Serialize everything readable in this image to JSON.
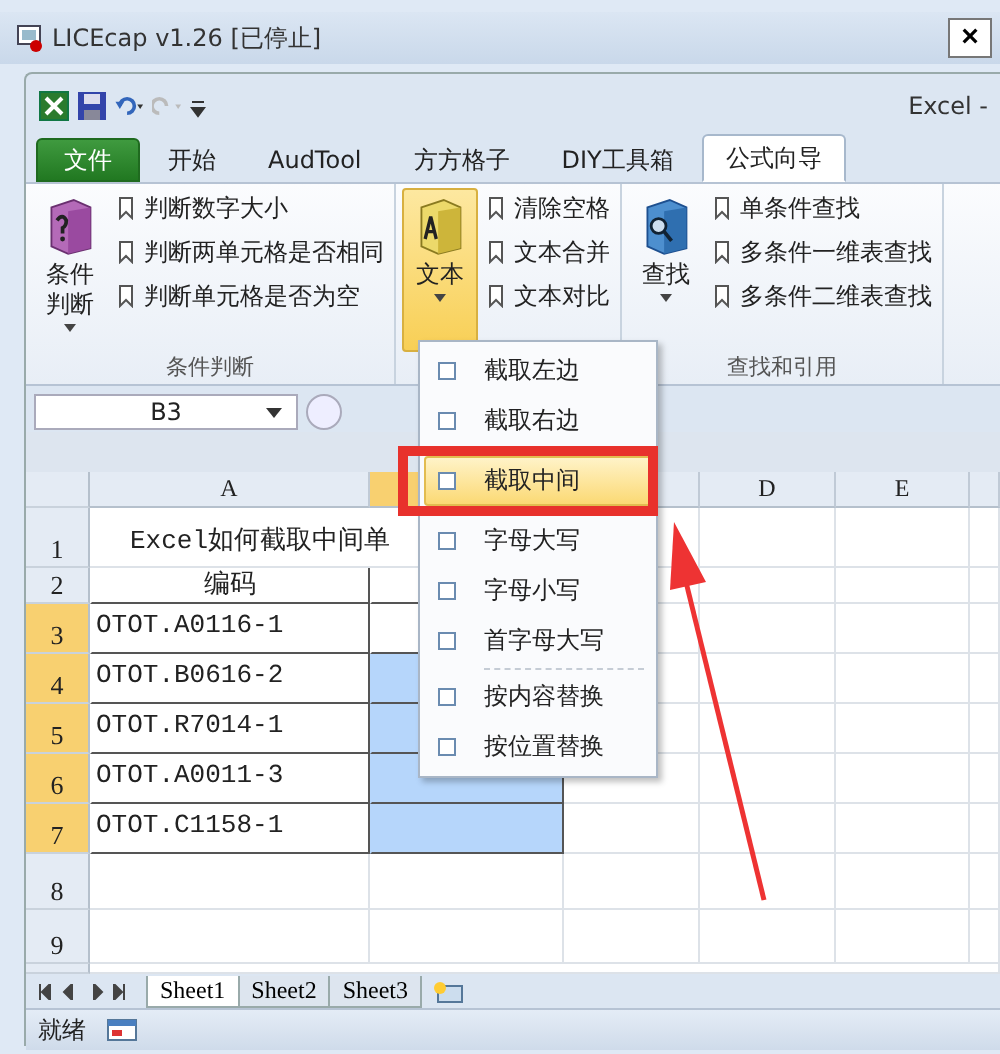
{
  "window": {
    "title": "LICEcap v1.26 [已停止]",
    "close": "×"
  },
  "app_label": "Excel -",
  "tabs": [
    {
      "label": "文件",
      "kind": "file",
      "selected": false
    },
    {
      "label": "开始",
      "kind": "normal",
      "selected": false
    },
    {
      "label": "AudTool",
      "kind": "normal",
      "selected": false
    },
    {
      "label": "方方格子",
      "kind": "normal",
      "selected": false
    },
    {
      "label": "DIY工具箱",
      "kind": "normal",
      "selected": false
    },
    {
      "label": "公式向导",
      "kind": "normal",
      "selected": true
    }
  ],
  "ribbon_groups": [
    {
      "label": "条件判断",
      "big_button": {
        "label": "条件判断",
        "expanded": false
      },
      "items": [
        "判断数字大小",
        "判断两单元格是否相同",
        "判断单元格是否为空"
      ]
    },
    {
      "big_button": {
        "label": "文本",
        "expanded": true
      },
      "items": [
        "清除空格",
        "文本合并",
        "文本对比"
      ]
    },
    {
      "label": "查找和引用",
      "big_button": {
        "label": "查找",
        "expanded": false
      },
      "items": [
        "单条件查找",
        "多条件一维表查找",
        "多条件二维表查找"
      ]
    }
  ],
  "name_box": "B3",
  "columns": [
    {
      "label": "A",
      "selected": false
    },
    {
      "selected": true
    },
    {
      "selected": false
    },
    {
      "label": "D",
      "selected": false
    },
    {
      "label": "E",
      "selected": false
    }
  ],
  "rows": [
    {
      "number": "1",
      "selected": false,
      "cells": [
        {
          "text": "Excel如何截取中间单",
          "kind": "title"
        }
      ]
    },
    {
      "number": "2",
      "selected": false,
      "cells": [
        {
          "text": "编码",
          "kind": "header"
        },
        {
          "selected": false,
          "kind": "header"
        }
      ]
    },
    {
      "number": "3",
      "selected": true,
      "cells": [
        {
          "text": "OTOT.A0116-1",
          "kind": "data"
        },
        {
          "selected": false,
          "kind": "data"
        }
      ]
    },
    {
      "number": "4",
      "selected": true,
      "cells": [
        {
          "text": "OTOT.B0616-2",
          "kind": "data"
        },
        {
          "selected": true,
          "kind": "data"
        }
      ]
    },
    {
      "number": "5",
      "selected": true,
      "cells": [
        {
          "text": "OTOT.R7014-1",
          "kind": "data"
        },
        {
          "selected": true,
          "kind": "data"
        }
      ]
    },
    {
      "number": "6",
      "selected": true,
      "cells": [
        {
          "text": "OTOT.A0011-3",
          "kind": "data"
        },
        {
          "selected": true,
          "kind": "data"
        }
      ]
    },
    {
      "number": "7",
      "selected": true,
      "cells": [
        {
          "text": "OTOT.C1158-1",
          "kind": "data"
        },
        {
          "selected": true,
          "kind": "data"
        }
      ]
    },
    {
      "number": "8",
      "selected": false,
      "cells": []
    },
    {
      "number": "9",
      "selected": false,
      "cells": []
    }
  ],
  "menu": {
    "groups": [
      [
        {
          "label": "截取左边",
          "selected": false
        },
        {
          "label": "截取右边",
          "selected": false
        },
        {
          "label": "截取中间",
          "selected": true
        },
        {
          "label": "字母大写",
          "selected": false
        },
        {
          "label": "字母小写",
          "selected": false
        },
        {
          "label": "首字母大写",
          "selected": false
        }
      ],
      [
        {
          "label": "按内容替换",
          "selected": false
        },
        {
          "label": "按位置替换",
          "selected": false
        }
      ]
    ]
  },
  "sheet_tabs": [
    {
      "label": "Sheet1",
      "selected": true
    },
    {
      "label": "Sheet2",
      "selected": false
    },
    {
      "label": "Sheet3",
      "selected": false
    }
  ],
  "status": "就绪"
}
